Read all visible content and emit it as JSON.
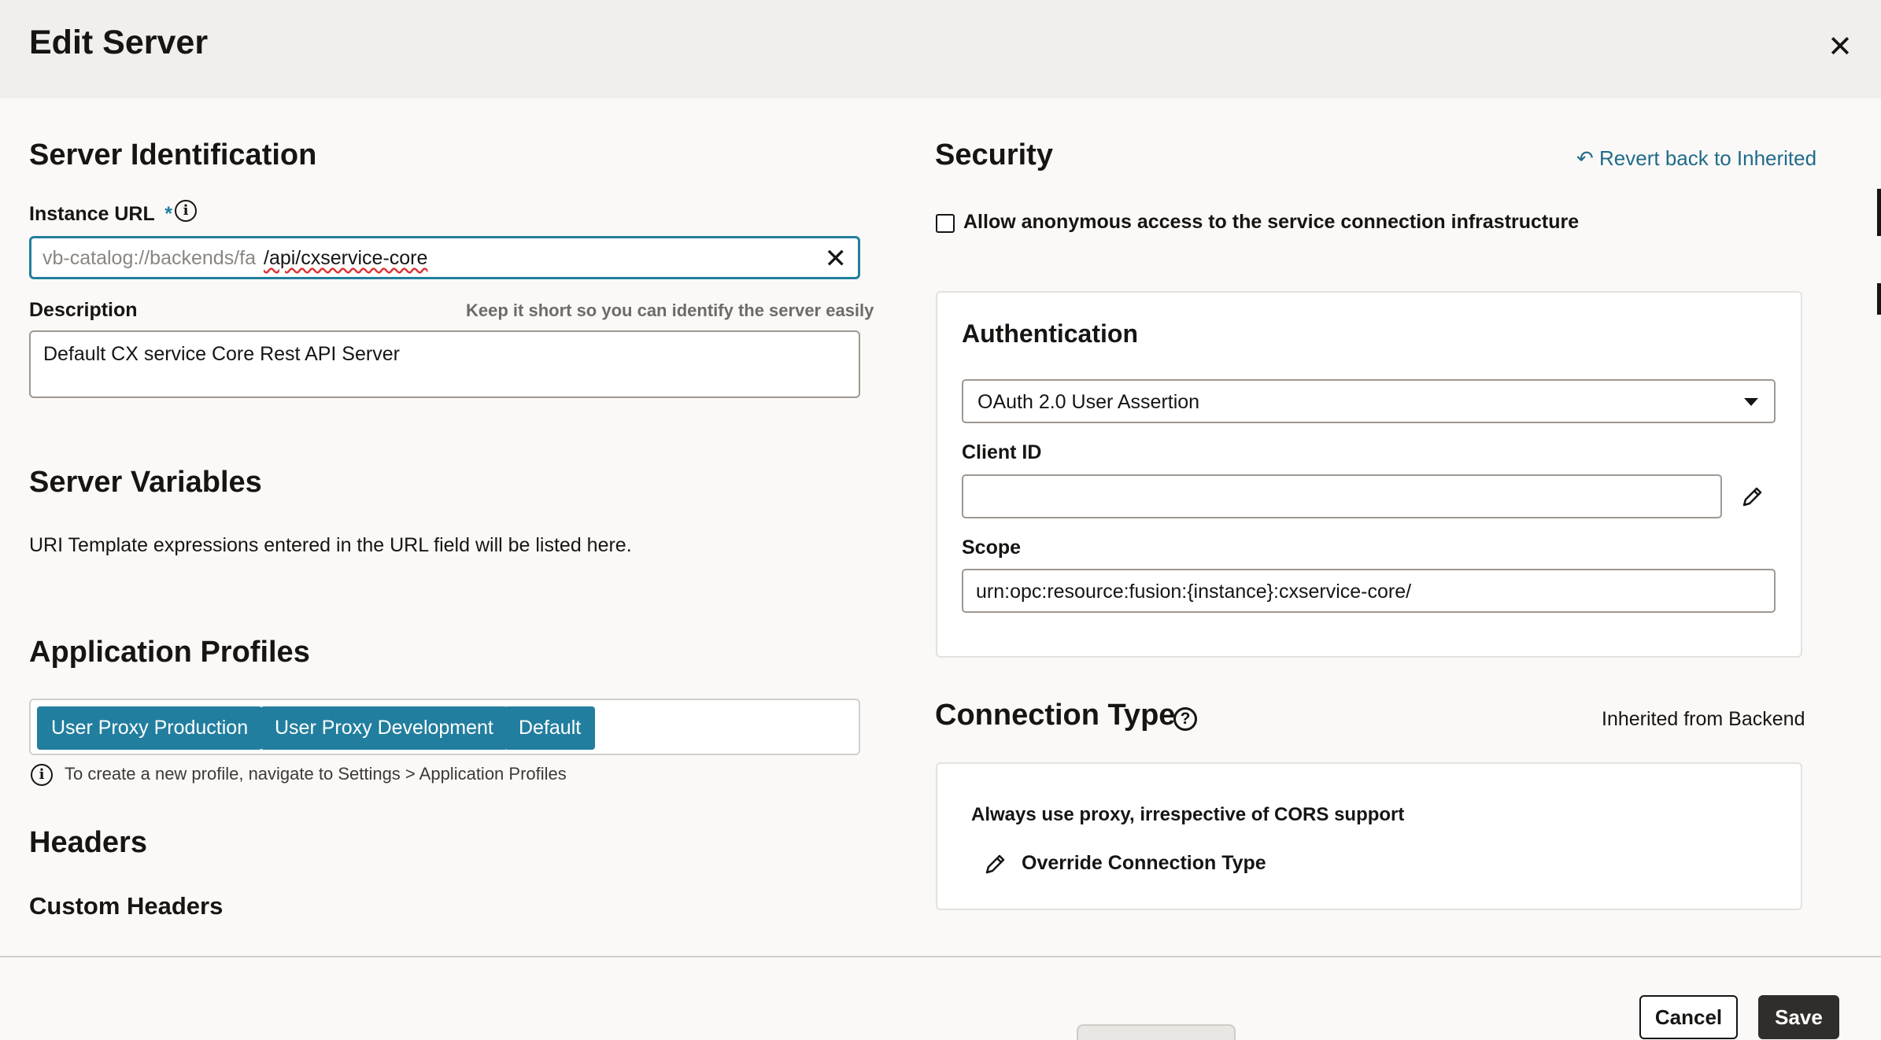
{
  "dialog": {
    "title": "Edit Server",
    "close_icon": "close-icon"
  },
  "identification": {
    "title": "Server Identification",
    "instance_url_label": "Instance URL",
    "required_marker": "*",
    "info_icon": "info-icon",
    "url_prefix": "vb-catalog://backends/fa",
    "url_value": "/api/cxservice-core",
    "clear_icon": "clear-icon",
    "description_label": "Description",
    "description_hint": "Keep it short so you can identify the server easily",
    "description_value": "Default CX service Core Rest API Server"
  },
  "server_variables": {
    "title": "Server Variables",
    "text": "URI Template expressions entered in the URL field will be listed here."
  },
  "application_profiles": {
    "title": "Application Profiles",
    "profiles": [
      "User Proxy Production",
      "User Proxy Development",
      "Default"
    ],
    "hint": "To create a new profile, navigate to Settings > Application Profiles"
  },
  "headers": {
    "title": "Headers",
    "custom_title": "Custom Headers"
  },
  "security": {
    "title": "Security",
    "revert_label": "Revert back to Inherited",
    "anonymous_label": "Allow anonymous access to the service connection infrastructure",
    "anonymous_checked": false
  },
  "authentication": {
    "title": "Authentication",
    "selected": "OAuth 2.0 User Assertion",
    "client_id_label": "Client ID",
    "client_id_value": "",
    "scope_label": "Scope",
    "scope_value": "urn:opc:resource:fusion:{instance}:cxservice-core/"
  },
  "connection_type": {
    "title": "Connection Type",
    "help_icon": "help-icon",
    "inherited_label": "Inherited from Backend",
    "description": "Always use proxy, irrespective of CORS support",
    "override_label": "Override Connection Type"
  },
  "footer": {
    "cancel_label": "Cancel",
    "save_label": "Save"
  },
  "colors": {
    "accent": "#227e9e",
    "link": "#1f6b8a",
    "save_button": "#312d2a"
  }
}
